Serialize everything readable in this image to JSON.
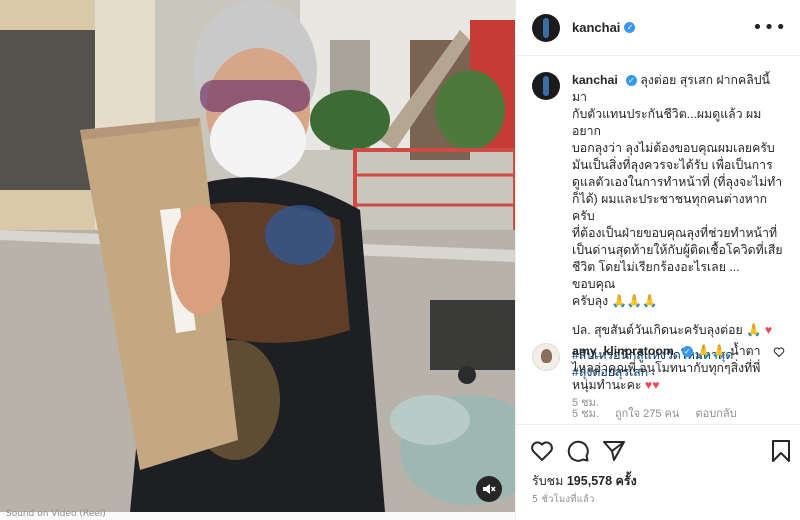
{
  "post": {
    "username": "kanchai",
    "caption_lines": [
      "ลุงต่อย สุรเสก ฝากคลิปนี้มา",
      "กับตัวแทนประกันชีวิต...ผมดูแล้ว ผมอยาก",
      "บอกลุงว่า ลุงไม่ต้องขอบคุณผมเลยครับ",
      "มันเป็นสิ่งที่ลุงควรจะได้รับ เพื่อเป็นการ",
      "ดูแลตัวเองในการทำหน้าที่ (ที่ลุงจะไม่ทำ",
      "ก็ได้) ผมและประชาชนทุกคนต่างหากครับ",
      "ที่ต้องเป็นฝ่ายขอบคุณลุงที่ช่วยทำหน้าที่",
      "เป็นด่านสุดท้ายให้กับผู้ติดเชื้อโควิดที่เสีย",
      "ชีวิต โดยไม่เรียกร้องอะไรเลย ... ขอบคุณ",
      "ครับลุง 🙏🙏🙏"
    ],
    "postscript": "ปล. สุขสันต์วันเกิดนะครับลุงต่อย 🙏",
    "postscript_heart": "♥",
    "hashtags": [
      "#สัปเหร่อนักสู้แห่งวัดใหม่ตาสุด",
      "#ลุงต่อยสุรเสก"
    ],
    "age": "5 ชม."
  },
  "comment": {
    "username": "amy_klinpratoom",
    "line1": "🙏🙏 น้ำตา",
    "line2": "ไหลอ่าคุณพี่ อนุโมทนากับทุกๆสิ่งที่พี่",
    "line3": "หนุ่มทำนะคะ",
    "hearts": "♥♥",
    "age": "5 ชม.",
    "likes": "ถูกใจ 275 คน",
    "reply": "ตอบกลับ"
  },
  "footer": {
    "views_label": "รับชม",
    "views_count": "195,578",
    "views_unit": "ครั้ง",
    "time": "5 ชั่วโมงที่แล้ว"
  },
  "media": {
    "caption_strip": "Sound on  Video (Reel)"
  },
  "icons": {
    "header_more": "more-icon",
    "like": "heart-icon",
    "comment": "comment-icon",
    "share": "share-icon",
    "save": "bookmark-icon",
    "sound": "speaker-muted-icon"
  },
  "colors": {
    "link": "#00376b",
    "verified": "#3897f0",
    "heart": "#ed4956",
    "muted": "#8e8e8e"
  }
}
